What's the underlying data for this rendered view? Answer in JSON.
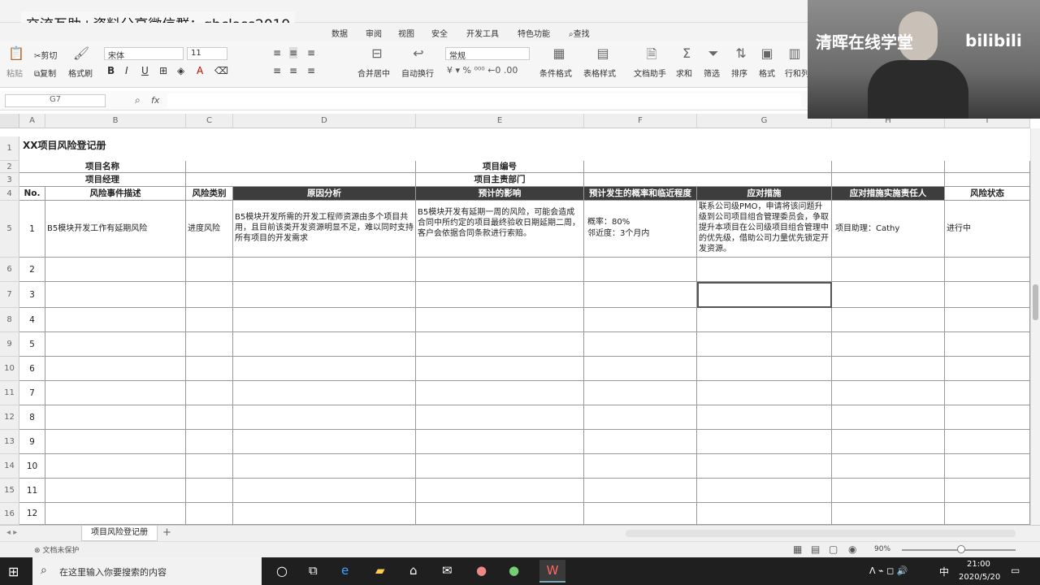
{
  "banner": "交流互助+资料分享微信群：qhclass2019",
  "watermark": "清晖在线学堂",
  "menu": [
    "数据",
    "审阅",
    "视图",
    "安全",
    "开发工具",
    "特色功能",
    "查找"
  ],
  "ribbon": {
    "cut": "剪切",
    "copy": "复制",
    "format_painter": "格式刷",
    "paste": "粘贴",
    "font": "宋体",
    "size": "11",
    "merge": "合并居中",
    "wrap": "自动换行",
    "numfmt": "常规",
    "cond": "条件格式",
    "table_style": "表格样式",
    "doc_helper": "文档助手",
    "sum": "求和",
    "filter": "筛选",
    "sort": "排序",
    "format": "格式",
    "rowcol": "行和列",
    "bold": "B",
    "italic": "I",
    "underline": "U"
  },
  "formula": {
    "cell_ref": "G7",
    "fx": "fx"
  },
  "columns": [
    "A",
    "B",
    "C",
    "D",
    "E",
    "F",
    "G",
    "H",
    "I"
  ],
  "sheet": {
    "title": "XX项目风险登记册",
    "project_name_label": "项目名称",
    "project_no_label": "项目编号",
    "project_manager_label": "项目经理",
    "project_dept_label": "项目主责部门",
    "headers": [
      "No.",
      "风险事件描述",
      "风险类别",
      "原因分析",
      "预计的影响",
      "预计发生的概率和临近程度",
      "应对措施",
      "应对措施实施责任人",
      "风险状态"
    ],
    "row1": {
      "no": "1",
      "desc": "B5模块开发工作有延期风险",
      "category": "进度风险",
      "cause": "B5模块开发所需的开发工程师资源由多个项目共用，且目前该类开发资源明显不足，难以同时支持所有项目的开发需求",
      "impact": "B5模块开发有延期一周的风险，可能会造成合同中所约定的项目最终验收日期延期二周，客户会依据合同条款进行索赔。",
      "prob": "概率：80%",
      "proximity": "邻近度：3个月内",
      "response": "联系公司级PMO，申请将该问题升级到公司项目组合管理委员会，争取提升本项目在公司级项目组合管理中的优先级，借助公司力量优先锁定开发资源。",
      "owner": "项目助理：Cathy",
      "status": "进行中"
    },
    "row_numbers": [
      "2",
      "3",
      "4",
      "5",
      "6",
      "7",
      "8",
      "9",
      "10",
      "11",
      "12"
    ],
    "row_headers": [
      "1",
      "2",
      "3",
      "4",
      "5",
      "6",
      "7",
      "8",
      "9",
      "10",
      "11",
      "12",
      "13",
      "14",
      "15",
      "16"
    ]
  },
  "sheet_tab": "项目风险登记册",
  "status": {
    "doc_protect": "文档未保护",
    "zoom": "90%"
  },
  "taskbar": {
    "search": "在这里输入你要搜索的内容",
    "ime": "中",
    "time": "21:00",
    "date": "2020/5/20"
  }
}
